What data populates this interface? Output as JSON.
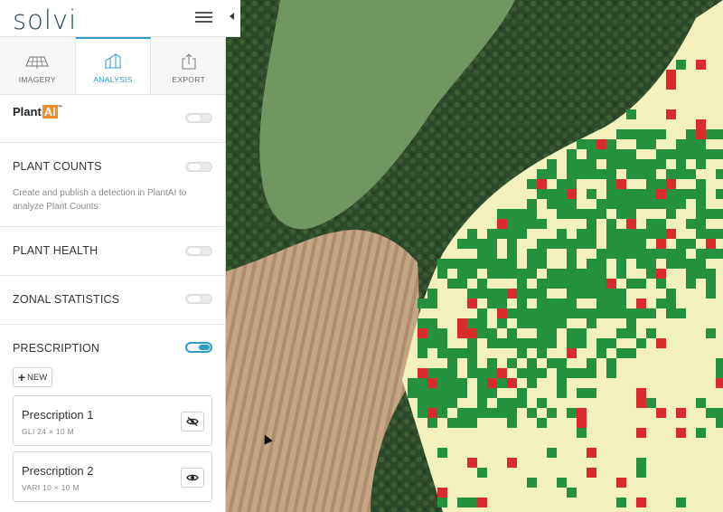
{
  "app": {
    "logo_text": "solvi"
  },
  "tabs": [
    {
      "label": "IMAGERY",
      "icon": "solar-panel-icon"
    },
    {
      "label": "ANALYSIS",
      "icon": "chart-layers-icon",
      "active": true
    },
    {
      "label": "EXPORT",
      "icon": "upload-icon"
    }
  ],
  "plantai": {
    "brand_plant": "Plant",
    "brand_ai": "AI",
    "tm": "™",
    "enabled": false
  },
  "plant_counts": {
    "title": "PLANT COUNTS",
    "enabled": false,
    "description": "Create and publish a detection in PlantAI to analyze Plant Counts"
  },
  "plant_health": {
    "title": "PLANT HEALTH",
    "enabled": false
  },
  "zonal_statistics": {
    "title": "ZONAL STATISTICS",
    "enabled": false
  },
  "prescription": {
    "title": "PRESCRIPTION",
    "enabled": true,
    "new_button_label": "NEW",
    "items": [
      {
        "name": "Prescription 1",
        "subtitle": "GLI 24 × 10 M",
        "visible": false
      },
      {
        "name": "Prescription 2",
        "subtitle": "VARI 10 × 10 M",
        "visible": true
      }
    ]
  },
  "map_colors": {
    "zone_low": "#d92b2b",
    "zone_mid": "#f2f0bd",
    "zone_high": "#23913e",
    "accent": "#2a9ec8"
  }
}
